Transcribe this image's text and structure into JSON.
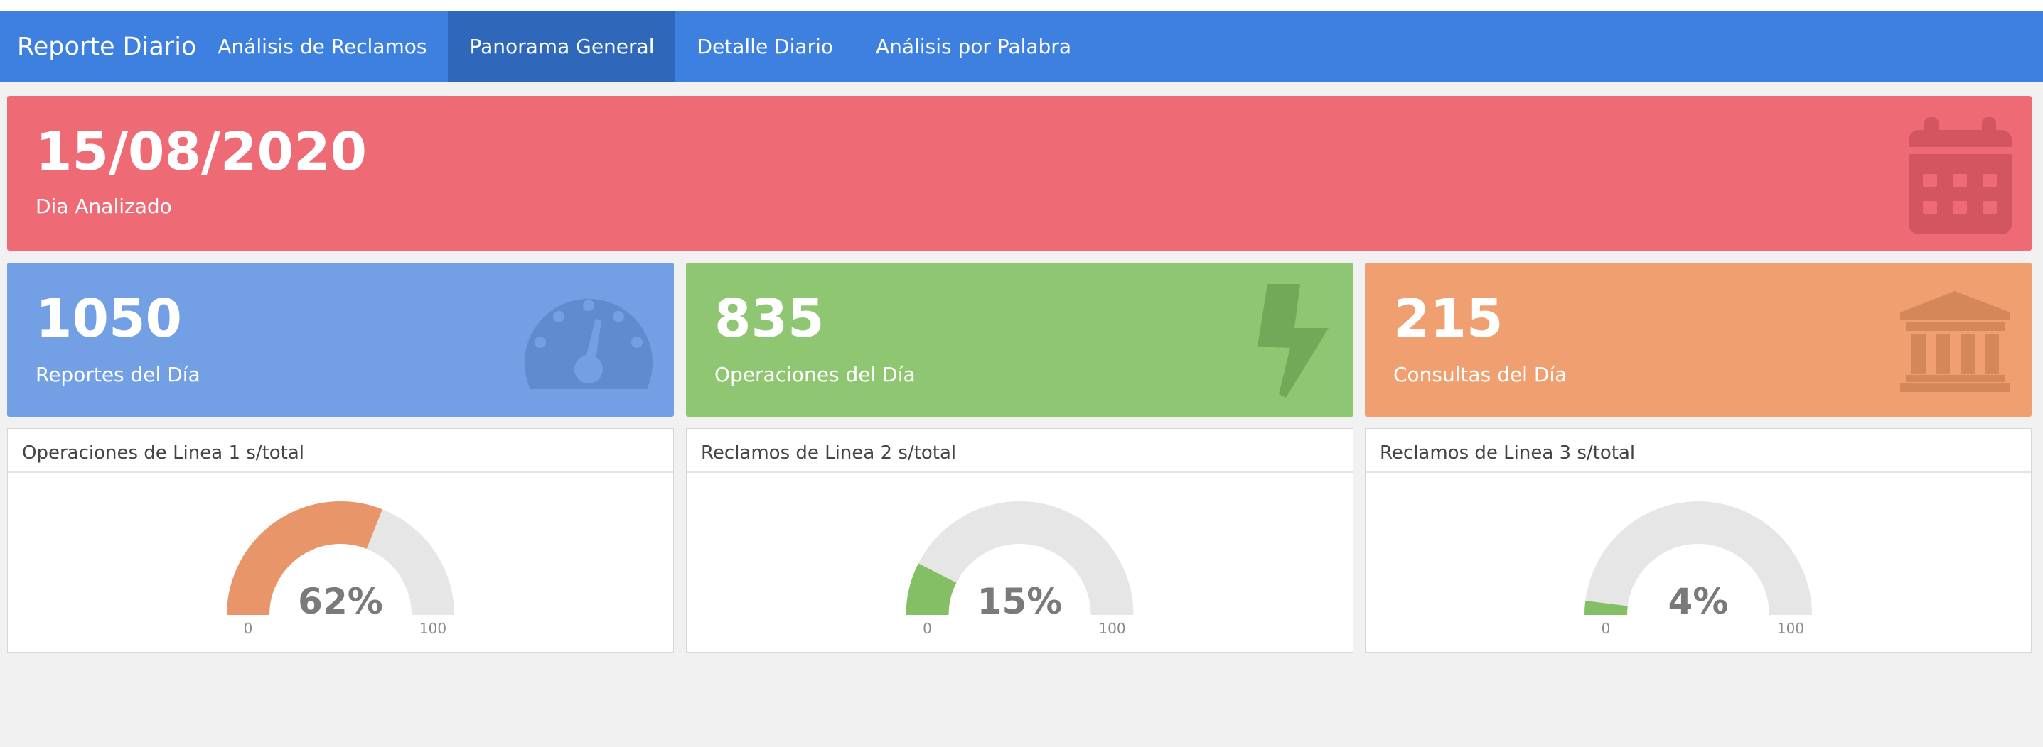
{
  "navbar": {
    "brand": "Reporte Diario",
    "links": [
      {
        "label": "Análisis de Reclamos",
        "active": false
      },
      {
        "label": "Panorama General",
        "active": true
      },
      {
        "label": "Detalle Diario",
        "active": false
      },
      {
        "label": "Análisis por Palabra",
        "active": false
      }
    ]
  },
  "date_box": {
    "value": "15/08/2020",
    "label": "Dia Analizado",
    "icon": "calendar-icon",
    "color": "#ee6b76"
  },
  "stats": [
    {
      "value": "1050",
      "label": "Reportes del Día",
      "icon": "dashboard-gauge-icon",
      "color": "#73a0e4"
    },
    {
      "value": "835",
      "label": "Operaciones del Día",
      "icon": "lightning-bolt-icon",
      "color": "#8fc672"
    },
    {
      "value": "215",
      "label": "Consultas del Día",
      "icon": "bank-institution-icon",
      "color": "#f0a070"
    }
  ],
  "gauges": [
    {
      "title": "Operaciones de Linea 1 s/total",
      "value": 62,
      "display": "62%",
      "min": "0",
      "max": "100",
      "color": "#e89669"
    },
    {
      "title": "Reclamos de Linea 2 s/total",
      "value": 15,
      "display": "15%",
      "min": "0",
      "max": "100",
      "color": "#84bf66"
    },
    {
      "title": "Reclamos de Linea 3 s/total",
      "value": 4,
      "display": "4%",
      "min": "0",
      "max": "100",
      "color": "#84bf66"
    }
  ]
}
